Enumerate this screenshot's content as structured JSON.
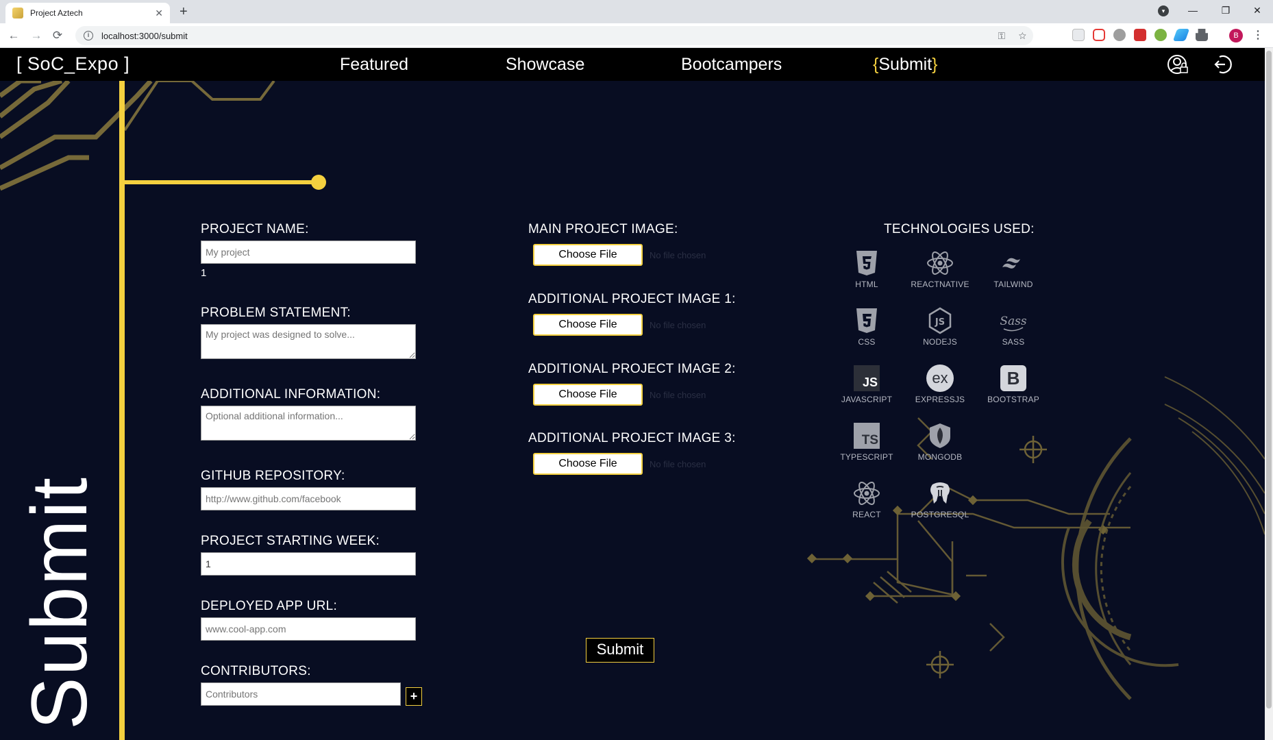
{
  "browser": {
    "tab_title": "Project Aztech",
    "tab_close": "✕",
    "new_tab": "+",
    "url": "localhost:3000/submit",
    "back": "←",
    "forward": "→",
    "reload": "⟳",
    "info": "i",
    "avatar_letter": "B",
    "menu": "⋮",
    "minimize": "—",
    "maximize": "❐",
    "close": "✕",
    "profile_drop": "▾"
  },
  "nav": {
    "brand": "[ SoC_Expo ]",
    "links": [
      "Featured",
      "Showcase",
      "Bootcampers"
    ],
    "active_open": "{",
    "active_label": "Submit",
    "active_close": "}"
  },
  "page_heading": "Submit",
  "form": {
    "project_name_label": "PROJECT NAME:",
    "project_name_placeholder": "My project",
    "counter": "1",
    "problem_label": "PROBLEM STATEMENT:",
    "problem_placeholder": "My project was designed to solve...",
    "additional_label": "ADDITIONAL INFORMATION:",
    "additional_placeholder": "Optional additional information...",
    "github_label": "GITHUB REPOSITORY:",
    "github_placeholder": "http://www.github.com/facebook",
    "week_label": "PROJECT STARTING WEEK:",
    "week_value": "1",
    "deployed_label": "DEPLOYED APP URL:",
    "deployed_placeholder": "www.cool-app.com",
    "contributors_label": "CONTRIBUTORS:",
    "contributors_placeholder": "Contributors",
    "add_contributor": "+"
  },
  "images": {
    "main_label": "MAIN PROJECT IMAGE:",
    "add1_label": "ADDITIONAL PROJECT IMAGE 1:",
    "add2_label": "ADDITIONAL PROJECT IMAGE 2:",
    "add3_label": "ADDITIONAL PROJECT IMAGE 3:",
    "choose_file": "Choose File",
    "no_file": "No file chosen"
  },
  "submit_button": "Submit",
  "technologies": {
    "title": "TECHNOLOGIES USED:",
    "items": [
      {
        "label": "HTML",
        "icon": "html5-icon"
      },
      {
        "label": "REACTNATIVE",
        "icon": "react-native-icon"
      },
      {
        "label": "TAILWIND",
        "icon": "tailwind-icon"
      },
      {
        "label": "CSS",
        "icon": "css3-icon"
      },
      {
        "label": "NODEJS",
        "icon": "nodejs-icon"
      },
      {
        "label": "SASS",
        "icon": "sass-icon"
      },
      {
        "label": "JAVASCRIPT",
        "icon": "javascript-icon"
      },
      {
        "label": "EXPRESSJS",
        "icon": "expressjs-icon"
      },
      {
        "label": "BOOTSTRAP",
        "icon": "bootstrap-icon"
      },
      {
        "label": "TYPESCRIPT",
        "icon": "typescript-icon"
      },
      {
        "label": "MONGODB",
        "icon": "mongodb-icon"
      },
      {
        "label": "REACT",
        "icon": "react-icon"
      },
      {
        "label": "POSTGRESQL",
        "icon": "postgresql-icon"
      }
    ],
    "js_glyph": "JS",
    "ts_glyph": "TS",
    "ex_glyph": "ex",
    "b_glyph": "B"
  },
  "colors": {
    "accent": "#f4d03f",
    "background": "#080d22",
    "nav_bg": "#000000",
    "circuit": "#7d6f3a"
  }
}
